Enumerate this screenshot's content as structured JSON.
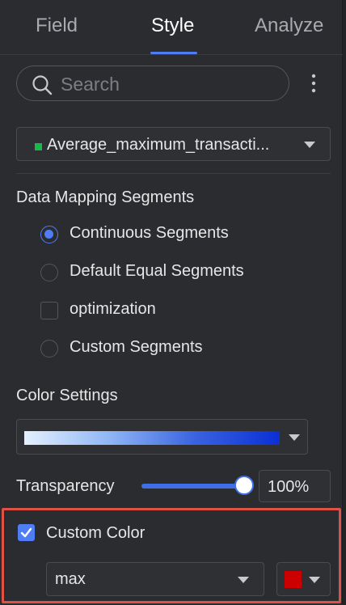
{
  "tabs": {
    "field": "Field",
    "style": "Style",
    "analyze": "Analyze",
    "active": "Style"
  },
  "search": {
    "placeholder": "Search",
    "icon": "search-icon"
  },
  "more_menu_icon": "vertical-ellipsis-icon",
  "field_select": {
    "value": "Average_maximum_transacti...",
    "indicator_color": "#19b84a"
  },
  "data_mapping": {
    "title": "Data Mapping Segments",
    "options": [
      {
        "label": "Continuous Segments",
        "type": "radio",
        "checked": true
      },
      {
        "label": "Default Equal Segments",
        "type": "radio",
        "checked": false
      },
      {
        "label": "optimization",
        "type": "checkbox",
        "checked": false
      },
      {
        "label": "Custom Segments",
        "type": "radio",
        "checked": false
      }
    ]
  },
  "color_settings": {
    "title": "Color Settings",
    "gradient_colors": [
      "#e4f0ff",
      "#8fb6f5",
      "#3a63e0",
      "#0a2fd6"
    ]
  },
  "transparency": {
    "label": "Transparency",
    "value_percent": 100,
    "display": "100%"
  },
  "custom_color": {
    "label": "Custom Color",
    "checked": true,
    "select_value": "max",
    "swatch_color": "#cc0000"
  },
  "colors": {
    "accent": "#4f7df5",
    "highlight_border": "#e05248"
  }
}
